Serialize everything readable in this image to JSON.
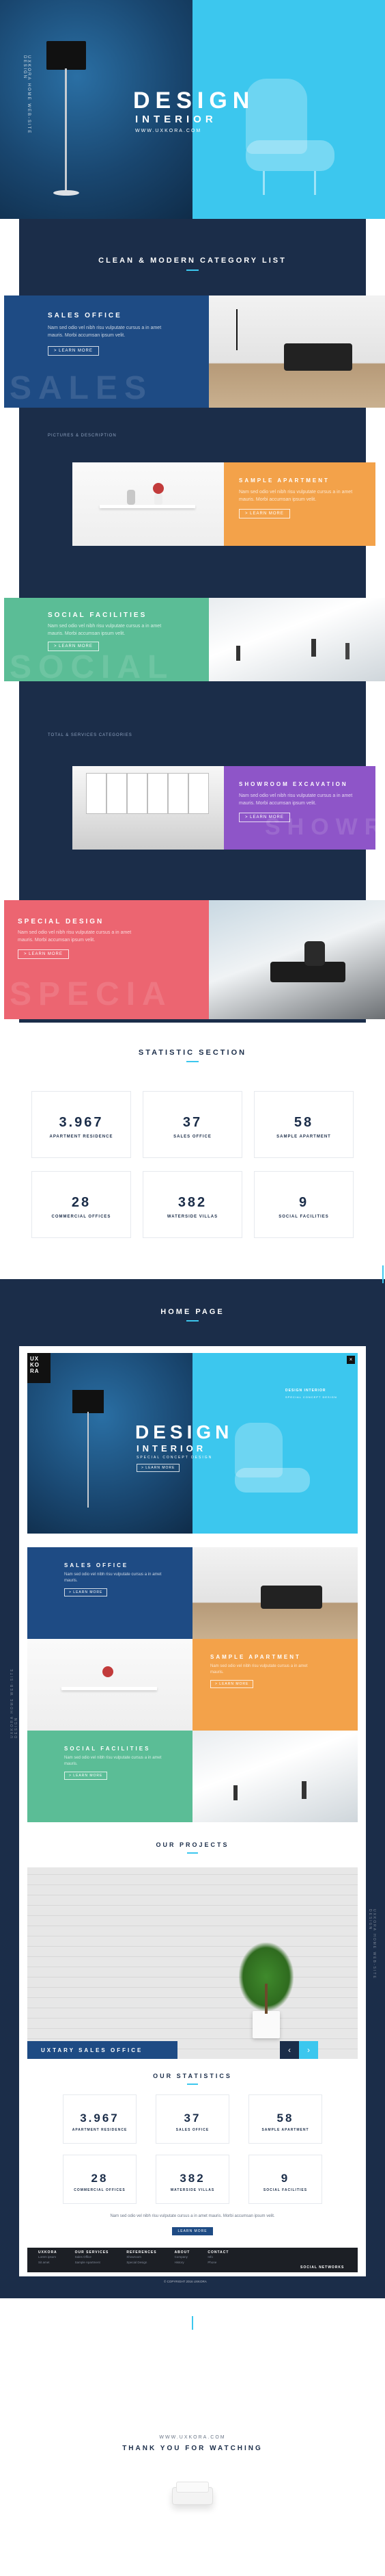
{
  "hero": {
    "title": "DESIGN",
    "subtitle": "INTERIOR",
    "url": "WWW.UXKORA.COM",
    "vertical_text": "UXKORA HOME WEB-SITE DESIGN"
  },
  "category_list": {
    "heading": "CLEAN & MODERN CATEGORY LIST",
    "lorem": "Nam sed odio vel nibh risu vulputate cursus a in amet mauris. Morbi accumsan ipsum velit.",
    "button_label": "> LEARN MORE",
    "items": [
      {
        "title": "SALES OFFICE",
        "ghost": "SALES"
      },
      {
        "title": "SAMPLE APARTMENT",
        "ghost": ""
      },
      {
        "title": "SOCIAL FACILITIES",
        "ghost": "SOCIAL"
      },
      {
        "title": "SHOWROOM EXCAVATION",
        "ghost": "SHOWR"
      },
      {
        "title": "SPECIAL DESIGN",
        "ghost": "SPECIA"
      }
    ],
    "section_label_1": "PICTURES & DESCRIPTION",
    "section_label_2": "TOTAL & SERVICES CATEGORIES"
  },
  "statistic": {
    "heading": "STATISTIC SECTION",
    "items": [
      {
        "value": "3.967",
        "label": "APARTMENT RESIDENCE"
      },
      {
        "value": "37",
        "label": "SALES OFFICE"
      },
      {
        "value": "58",
        "label": "SAMPLE APARTMENT"
      },
      {
        "value": "28",
        "label": "COMMERCIAL OFFICES"
      },
      {
        "value": "382",
        "label": "WATERSIDE VILLAS"
      },
      {
        "value": "9",
        "label": "SOCIAL FACILITIES"
      }
    ]
  },
  "homepage": {
    "heading": "HOME PAGE",
    "logo_lines": [
      "UX",
      "KO",
      "RA"
    ],
    "hero_title": "DESIGN",
    "hero_subtitle": "INTERIOR",
    "hero_tagline": "SPECIAL CONCEPT DESIGN",
    "hero_button": "> LEARN MORE",
    "brand_top": "DESIGN INTERIOR",
    "brand_sub": "SPECIAL CONCEPT DESIGN",
    "sidebar_vertical": "UXKORA HOME WEB-SITE DESIGN",
    "categories": [
      {
        "title": "SALES OFFICE"
      },
      {
        "title": "SAMPLE APARTMENT"
      },
      {
        "title": "SOCIAL FACILITIES"
      }
    ],
    "cat_lorem": "Nam sed odio vel nibh risu vulputate cursus a in amet mauris.",
    "cat_button": "> LEARN MORE",
    "projects_heading": "OUR PROJECTS",
    "project_label": "UXTARY SALES OFFICE",
    "pager_prev": "‹",
    "pager_next": "›",
    "stats_heading": "OUR STATISTICS",
    "stats_lorem": "Nam sed odio vel nibh risu vulputate cursus a in amet mauris. Morbi accumsan ipsum velit.",
    "stats_button": "LEARN MORE",
    "footer_columns": [
      {
        "title": "UXKORA",
        "links": [
          "Lorem ipsum",
          "Sit amet",
          "Consectetur"
        ]
      },
      {
        "title": "OUR SERVICES",
        "links": [
          "Sales Office",
          "Sample Apartment",
          "Social Facilities"
        ]
      },
      {
        "title": "REFERENCES",
        "links": [
          "Showroom",
          "Special Design",
          "Gallery"
        ]
      },
      {
        "title": "ABOUT",
        "links": [
          "Company",
          "History",
          "Team"
        ]
      },
      {
        "title": "CONTACT",
        "links": [
          "Info",
          "Phone",
          "Address"
        ]
      }
    ],
    "footer_projects_title": "PROJECTS",
    "social_label": "SOCIAL NETWORKS",
    "copyright": "© COPYRIGHT 2016 UXKORA"
  },
  "closing": {
    "url": "WWW.UXKORA.COM",
    "thanks": "THANK YOU FOR WATCHING"
  },
  "colors": {
    "navy": "#1b2d49",
    "blue": "#1e4b84",
    "cyan": "#3cc7ee",
    "orange": "#f3a24a",
    "green": "#5bbd96",
    "purple": "#8e55c8",
    "coral": "#ec6571"
  }
}
